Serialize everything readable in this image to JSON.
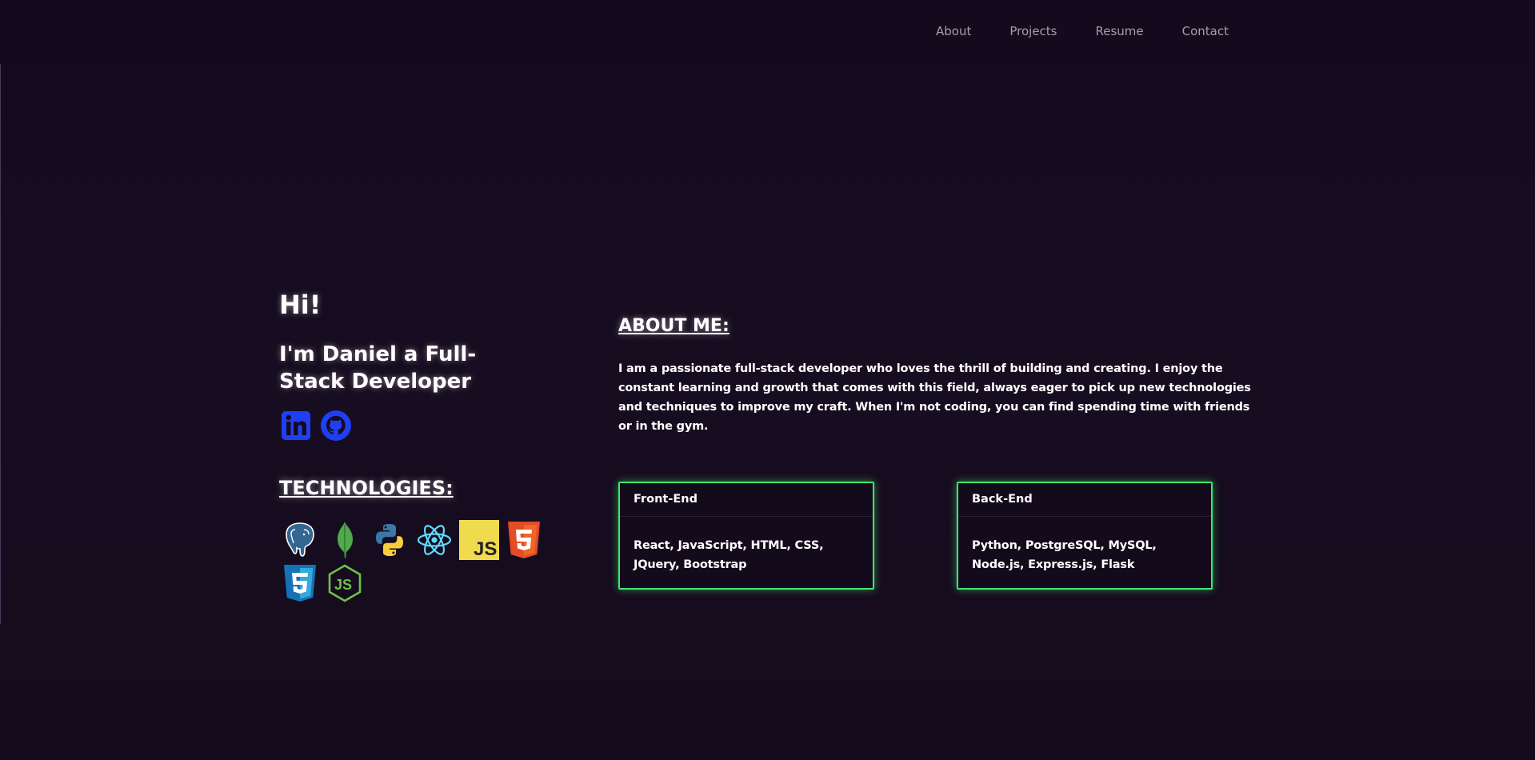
{
  "nav": {
    "items": [
      "About",
      "Projects",
      "Resume",
      "Contact"
    ]
  },
  "hero": {
    "greeting": "Hi!",
    "intro": "I'm Daniel a Full-Stack Developer"
  },
  "socials": [
    {
      "icon": "linkedin-icon",
      "color": "#1f3ff5"
    },
    {
      "icon": "github-icon",
      "color": "#1f3ff5"
    }
  ],
  "technologies": {
    "title": "TECHNOLOGIES:",
    "icons": [
      "postgresql-icon",
      "mongodb-icon",
      "python-icon",
      "react-icon",
      "javascript-icon",
      "html5-icon",
      "css3-icon",
      "nodejs-icon"
    ]
  },
  "about": {
    "title": "ABOUT ME:",
    "text": "I am a passionate full-stack developer who loves the thrill of building and creating. I enjoy the constant learning and growth that comes with this field, always eager to pick up new technologies and techniques to improve my craft. When I'm not coding, you can find spending time with friends or in the gym."
  },
  "cards": {
    "front": {
      "title": "Front-End",
      "body": "React, JavaScript, HTML, CSS, JQuery, Bootstrap"
    },
    "back": {
      "title": "Back-End",
      "body": "Python, PostgreSQL, MySQL, Node.js, Express.js, Flask"
    }
  },
  "colors": {
    "background": "#150b1f",
    "accent_green": "#3fe86f",
    "social_blue": "#1f3ff5",
    "nav_text": "#a3a0a8"
  }
}
